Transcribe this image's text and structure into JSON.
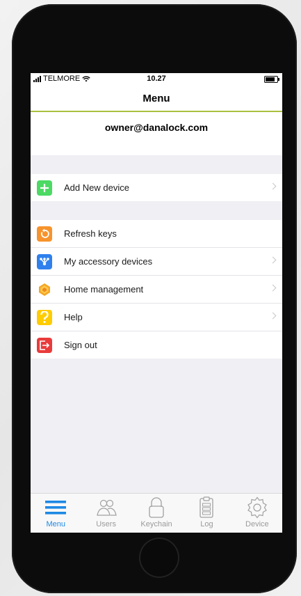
{
  "status_bar": {
    "carrier": "TELMORE",
    "time": "10.27"
  },
  "nav": {
    "title": "Menu"
  },
  "account": {
    "email": "owner@danalock.com"
  },
  "menu_group1": [
    {
      "label": "Add New device",
      "icon": "plus-icon",
      "color": "#4cd964",
      "chevron": true
    }
  ],
  "menu_group2": [
    {
      "label": "Refresh keys",
      "icon": "refresh-icon",
      "color": "#f7932c",
      "chevron": false
    },
    {
      "label": "My accessory devices",
      "icon": "accessory-hub-icon",
      "color": "#2f80ed",
      "chevron": true
    },
    {
      "label": "Home management",
      "icon": "homekit-icon",
      "color": "#f5a623",
      "chevron": true
    },
    {
      "label": "Help",
      "icon": "question-icon",
      "color": "#ffcc00",
      "chevron": true
    },
    {
      "label": "Sign out",
      "icon": "sign-out-icon",
      "color": "#e93b3b",
      "chevron": false
    }
  ],
  "tabs": [
    {
      "label": "Menu",
      "icon": "menu-icon",
      "active": true
    },
    {
      "label": "Users",
      "icon": "users-icon",
      "active": false
    },
    {
      "label": "Keychain",
      "icon": "padlock-icon",
      "active": false
    },
    {
      "label": "Log",
      "icon": "clipboard-icon",
      "active": false
    },
    {
      "label": "Device",
      "icon": "gear-icon",
      "active": false
    }
  ],
  "colors": {
    "accent": "#1e88e5",
    "nav_underline": "#a8c03c",
    "background": "#efeff4"
  }
}
